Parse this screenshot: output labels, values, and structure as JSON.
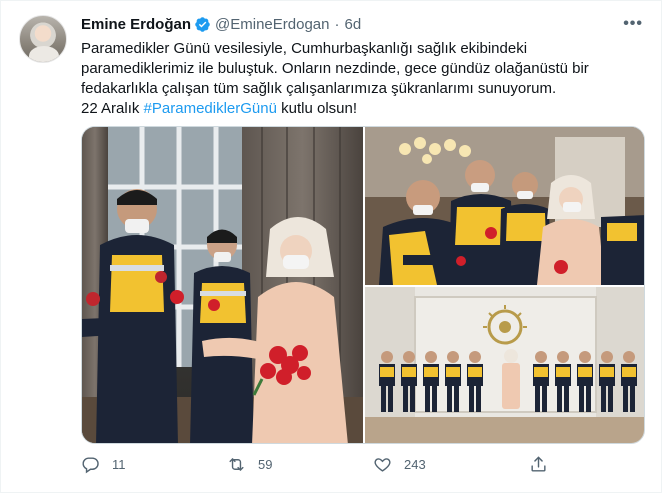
{
  "tweet": {
    "author_name": "Emine Erdoğan",
    "handle": "@EmineErdogan",
    "separator": "·",
    "time": "6d",
    "more_label": "•••",
    "text_lines": [
      "Paramedikler Günü vesilesiyle, Cumhurbaşkanlığı sağlık ekibindeki",
      "paramediklerimiz ile buluştuk. Onların nezdinde, gece gündüz olağanüstü bir",
      "fedakarlıkla çalışan tüm sağlık çalışanlarımıza şükranlarımı sunuyorum."
    ],
    "last_line_prefix": "22 Aralık ",
    "hashtag": "#ParamediklerGünü",
    "last_line_suffix": " kutlu olsun!"
  },
  "stats": {
    "replies": "11",
    "retweets": "59",
    "likes": "243"
  },
  "icons": {
    "verified": "verified-badge-icon",
    "reply": "reply-icon",
    "retweet": "retweet-icon",
    "like": "heart-icon",
    "share": "share-icon"
  },
  "colors": {
    "accent": "#1d9bf0",
    "secondary_text": "#536471",
    "uniform_yellow": "#f2c230",
    "uniform_navy": "#1c2436",
    "flower_red": "#d01f2a"
  }
}
